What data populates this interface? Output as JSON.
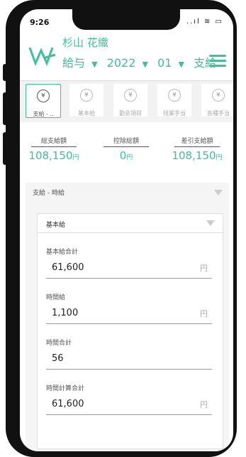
{
  "status": {
    "time": "9:26",
    "icons": "..ıl ≋ ▭"
  },
  "header": {
    "user_name": "杉山 花織",
    "type": "給与",
    "year": "2022",
    "month": "01",
    "kind": "支給",
    "caret": "▼"
  },
  "tabs": [
    {
      "label": "支給 - ..",
      "icon": "¥",
      "active": true
    },
    {
      "label": "基本給",
      "icon": "¥",
      "active": false
    },
    {
      "label": "勤怠項目",
      "icon": "¥",
      "active": false
    },
    {
      "label": "残業手当",
      "icon": "¥",
      "active": false
    },
    {
      "label": "各種手当",
      "icon": "¥",
      "active": false
    }
  ],
  "summary": [
    {
      "label": "総支給額",
      "value": "108,150",
      "unit": "円"
    },
    {
      "label": "控除総額",
      "value": "0",
      "unit": "円"
    },
    {
      "label": "差引支給額",
      "value": "108,150",
      "unit": "円"
    }
  ],
  "section": {
    "title": "支給 - 時給",
    "card_title": "基本給",
    "fields": [
      {
        "label": "基本給合計",
        "value": "61,600",
        "unit": "円"
      },
      {
        "label": "時間給",
        "value": "1,100",
        "unit": "円"
      },
      {
        "label": "時間合計",
        "value": "56",
        "unit": ""
      },
      {
        "label": "時間計算合計",
        "value": "61,600",
        "unit": "円"
      }
    ]
  },
  "colors": {
    "accent": "#3fbf9a"
  }
}
